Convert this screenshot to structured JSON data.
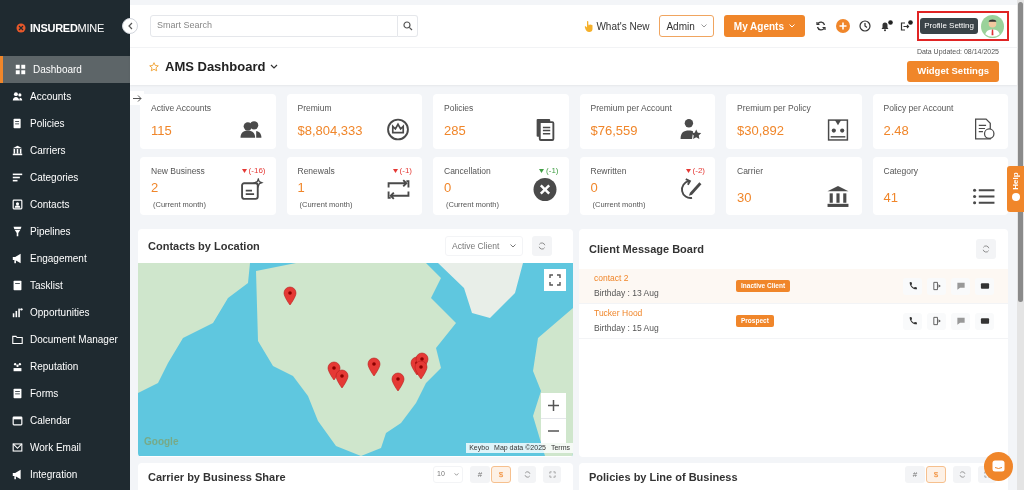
{
  "sidebar": {
    "logo_bold": "INSURED",
    "logo_light": "MINE",
    "items": [
      {
        "label": "Dashboard",
        "selected": true
      },
      {
        "label": "Accounts",
        "selected": false
      },
      {
        "label": "Policies",
        "selected": false
      },
      {
        "label": "Carriers",
        "selected": false
      },
      {
        "label": "Categories",
        "selected": false
      },
      {
        "label": "Contacts",
        "selected": false
      },
      {
        "label": "Pipelines",
        "selected": false
      },
      {
        "label": "Engagement",
        "selected": false
      },
      {
        "label": "Tasklist",
        "selected": false
      },
      {
        "label": "Opportunities",
        "selected": false
      },
      {
        "label": "Document Manager",
        "selected": false
      },
      {
        "label": "Reputation",
        "selected": false
      },
      {
        "label": "Forms",
        "selected": false
      },
      {
        "label": "Calendar",
        "selected": false
      },
      {
        "label": "Work Email",
        "selected": false
      },
      {
        "label": "Integration",
        "selected": false
      }
    ]
  },
  "topbar": {
    "search": {
      "placeholder": "Smart Search"
    },
    "whats_new": "What's New",
    "role_select": "Admin",
    "agents_button": "My Agents",
    "tooltip": "Profile Setting"
  },
  "header": {
    "title": "AMS Dashboard",
    "data_updated": "Data Updated: 08/14/2025",
    "widget_settings": "Widget Settings"
  },
  "cards": [
    {
      "label": "Active Accounts",
      "value": "115"
    },
    {
      "label": "Premium",
      "value": "$8,804,333"
    },
    {
      "label": "Policies",
      "value": "285"
    },
    {
      "label": "Premium per Account",
      "value": "$76,559"
    },
    {
      "label": "Premium per Policy",
      "value": "$30,892"
    },
    {
      "label": "Policy per Account",
      "value": "2.48"
    },
    {
      "label": "New Business",
      "value": "2",
      "delta": {
        "text": "(-16)",
        "color": "#e53935"
      },
      "note": "(Current month)"
    },
    {
      "label": "Renewals",
      "value": "1",
      "delta": {
        "text": "(-1)",
        "color": "#e53935"
      },
      "note": "(Current month)"
    },
    {
      "label": "Cancellation",
      "value": "0",
      "delta": {
        "text": "(-1)",
        "color": "#43a047"
      },
      "note": "(Current month)"
    },
    {
      "label": "Rewritten",
      "value": "0",
      "delta": {
        "text": "(-2)",
        "color": "#e53935"
      },
      "note": "(Current month)"
    },
    {
      "label": "Carrier",
      "value": "30"
    },
    {
      "label": "Category",
      "value": "41"
    }
  ],
  "contacts_by_location": {
    "title": "Contacts by Location",
    "filter": "Active Client",
    "map_logo": "Google",
    "attribution": [
      "Keybo",
      "Map data ©2025",
      "Terms"
    ]
  },
  "client_message_board": {
    "title": "Client Message Board",
    "rows": [
      {
        "name": "contact 2",
        "birthday": "Birthday : 13 Aug",
        "status": "Inactive Client",
        "selected": true
      },
      {
        "name": "Tucker Hood",
        "birthday": "Birthday : 15 Aug",
        "status": "Prospect",
        "selected": false
      }
    ]
  },
  "bottom_panels": [
    {
      "title": "Carrier by Business Share",
      "page_size": "10",
      "modes": [
        {
          "label": "#",
          "selected": false
        },
        {
          "label": "$",
          "selected": true
        }
      ]
    },
    {
      "title": "Policies by Line of Business",
      "modes": [
        {
          "label": "#",
          "selected": false
        },
        {
          "label": "$",
          "selected": true
        }
      ]
    }
  ],
  "help_tab": "Help"
}
